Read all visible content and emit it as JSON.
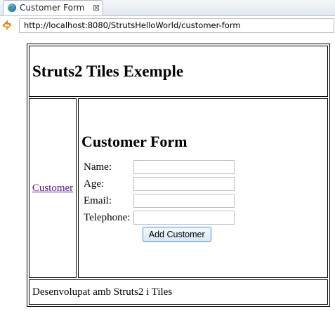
{
  "browser": {
    "tab_title": "Customer Form",
    "tab_close": "⊠",
    "url": "http://localhost:8080/StrutsHelloWorld/customer-form"
  },
  "page": {
    "header_title": "Struts2 Tiles Exemple",
    "menu_link": "Customer",
    "form_title": "Customer Form",
    "fields": [
      {
        "label": "Name:",
        "value": ""
      },
      {
        "label": "Age:",
        "value": ""
      },
      {
        "label": "Email:",
        "value": ""
      },
      {
        "label": "Telephone:",
        "value": ""
      }
    ],
    "submit_label": "Add Customer",
    "footer_text": "Desenvolupat amb Struts2 i Tiles"
  },
  "colors": {
    "link_visited": "#551a8b",
    "button_border": "#4f8fc8"
  }
}
